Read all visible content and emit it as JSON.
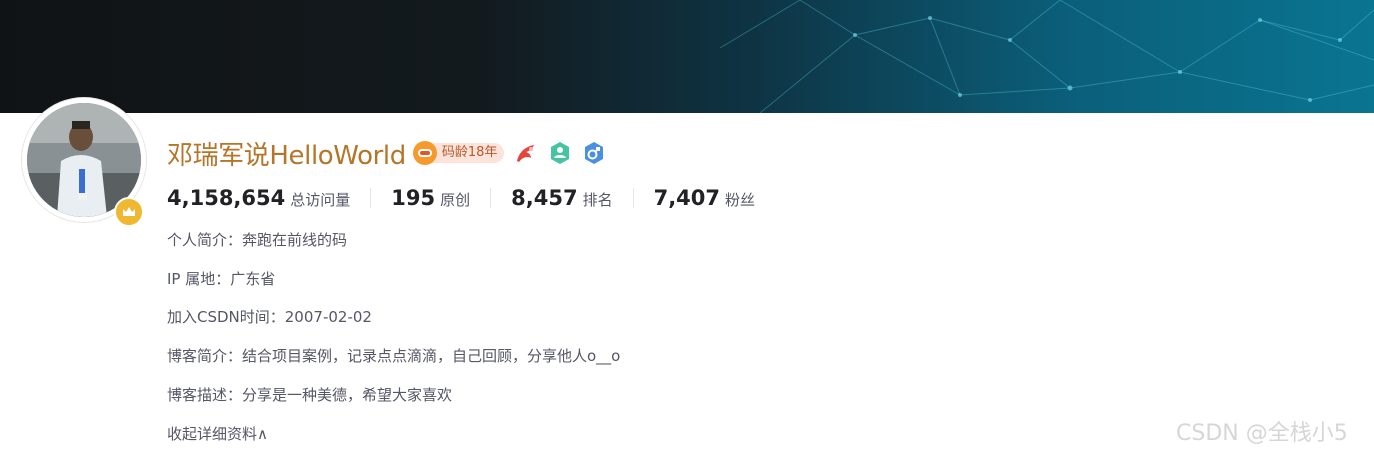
{
  "profile": {
    "name": "邓瑞军说HelloWorld",
    "code_age": "码龄18年",
    "avatar_icon": "user-avatar-photo",
    "avatar_badge_icon": "crown-badge-icon",
    "badges": [
      "achievement-flag-icon",
      "blog-expert-icon",
      "gender-male-icon"
    ]
  },
  "stats": [
    {
      "value": "4,158,654",
      "label": "总访问量"
    },
    {
      "value": "195",
      "label": "原创"
    },
    {
      "value": "8,457",
      "label": "排名"
    },
    {
      "value": "7,407",
      "label": "粉丝"
    }
  ],
  "info": {
    "intro": "个人简介：奔跑在前线的码",
    "ip": "IP 属地：广东省",
    "joined": "加入CSDN时间：2007-02-02",
    "blog_intro": "博客简介：结合项目案例，记录点点滴滴，自己回顾，分享他人o__o",
    "blog_desc": "博客描述：分享是一种美德，希望大家喜欢"
  },
  "collapse_link": "收起详细资料∧",
  "watermark": "CSDN @全栈小5",
  "colors": {
    "name": "#b5762a",
    "stat_number": "#222226",
    "muted_text": "#555666",
    "banner_accent": "#0a7591"
  }
}
